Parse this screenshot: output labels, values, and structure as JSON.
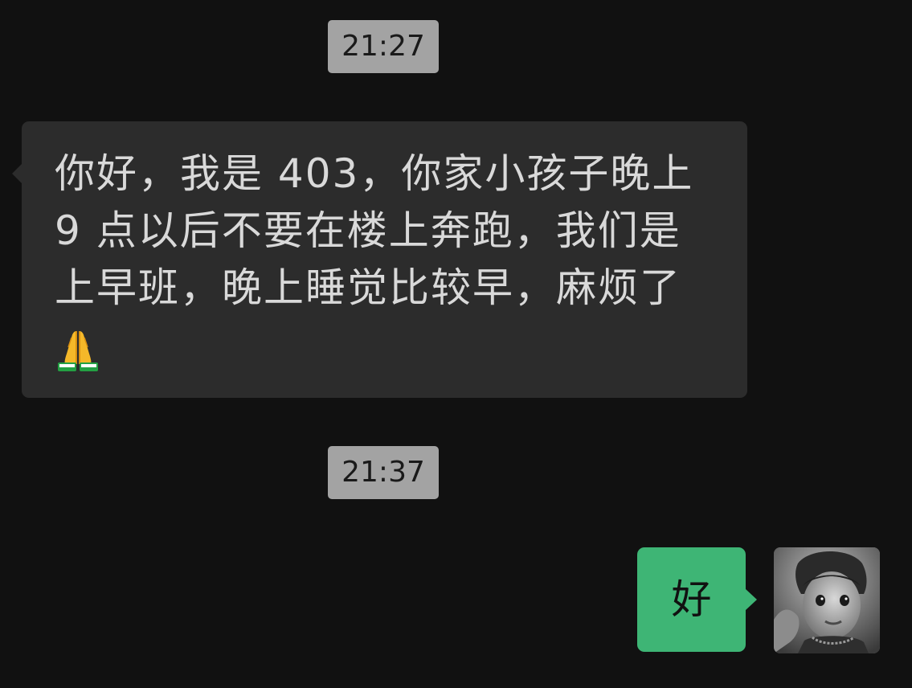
{
  "messages": {
    "time_1": "21:27",
    "incoming_text": "你好，我是 403，你家小孩子晚上 9 点以后不要在楼上奔跑，我们是上早班，晚上睡觉比较早，麻烦了",
    "incoming_emoji": "folded-hands-icon",
    "time_2": "21:37",
    "outgoing_text": "好"
  },
  "colors": {
    "background": "#111111",
    "incoming_bubble": "#2c2c2c",
    "outgoing_bubble": "#3eb575",
    "time_pill": "#a3a3a3"
  }
}
